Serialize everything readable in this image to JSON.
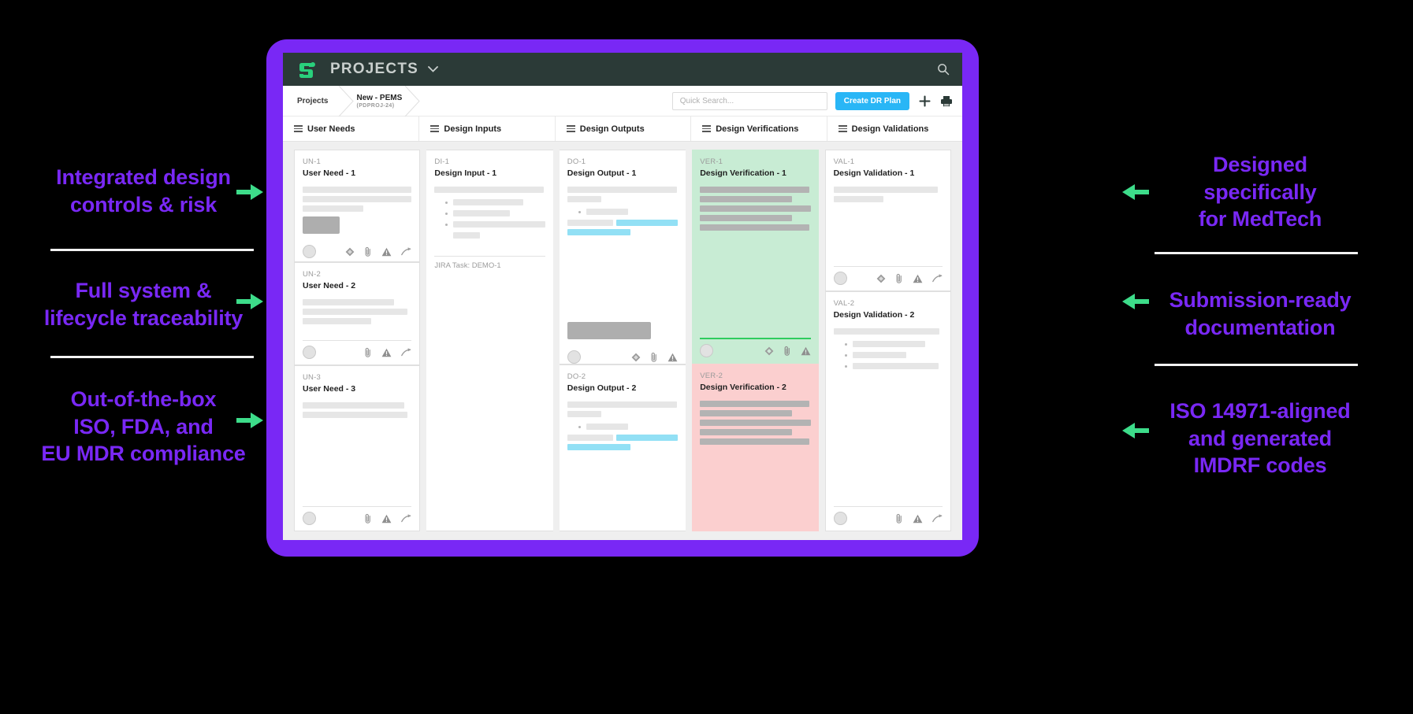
{
  "colors": {
    "accent_purple": "#7928f5",
    "arrow_green": "#3ddc8a",
    "topbar": "#2b3a37",
    "button_blue": "#29b6f6",
    "card_green": "#c8ecd4",
    "card_red": "#fbcfcf",
    "highlight_cyan": "#92e0f5",
    "board_bg": "#efefef"
  },
  "annotations": {
    "left": [
      {
        "text": "Integrated design\ncontrols & risk"
      },
      {
        "text": "Full system &\nlifecycle traceability"
      },
      {
        "text": "Out-of-the-box\nISO, FDA, and\nEU MDR compliance"
      }
    ],
    "right": [
      {
        "text": "Designed\nspecifically\nfor MedTech"
      },
      {
        "text": "Submission-ready\ndocumentation"
      },
      {
        "text": "ISO 14971-aligned\nand generated\nIMDRF codes"
      }
    ]
  },
  "app": {
    "title": "PROJECTS",
    "logo_icon": "greenlight-guru-logo-icon",
    "chevron_icon": "chevron-down-icon",
    "search_icon": "search-icon"
  },
  "breadcrumb": {
    "root": "Projects",
    "current": "New - PEMS",
    "current_code": "(PDPROJ-24)"
  },
  "toolbar": {
    "search_placeholder": "Quick Search...",
    "search_value": "",
    "create_button": "Create DR Plan",
    "add_icon": "plus-icon",
    "print_icon": "printer-icon"
  },
  "columns": [
    {
      "label": "User Needs",
      "menu_icon": "hamburger-icon"
    },
    {
      "label": "Design Inputs",
      "menu_icon": "hamburger-icon"
    },
    {
      "label": "Design Outputs",
      "menu_icon": "hamburger-icon"
    },
    {
      "label": "Design Verifications",
      "menu_icon": "hamburger-icon"
    },
    {
      "label": "Design Validations",
      "menu_icon": "hamburger-icon"
    }
  ],
  "cards": {
    "un1": {
      "id": "UN-1",
      "title": "User Need - 1"
    },
    "un2": {
      "id": "UN-2",
      "title": "User Need - 2"
    },
    "un3": {
      "id": "UN-3",
      "title": "User Need - 3"
    },
    "di1": {
      "id": "DI-1",
      "title": "Design Input - 1",
      "footer_note": "JIRA Task: DEMO-1"
    },
    "do1": {
      "id": "DO-1",
      "title": "Design Output - 1"
    },
    "do2": {
      "id": "DO-2",
      "title": "Design Output - 2"
    },
    "ver1": {
      "id": "VER-1",
      "title": "Design Verification - 1"
    },
    "ver2": {
      "id": "VER-2",
      "title": "Design Verification - 2"
    },
    "val1": {
      "id": "VAL-1",
      "title": "Design Validation - 1"
    },
    "val2": {
      "id": "VAL-2",
      "title": "Design Validation - 2"
    }
  },
  "card_icons": {
    "diamond": "diamond-icon",
    "attachment": "paperclip-icon",
    "risk": "warning-triangle-icon",
    "link": "arrow-link-icon",
    "avatar": "avatar"
  }
}
